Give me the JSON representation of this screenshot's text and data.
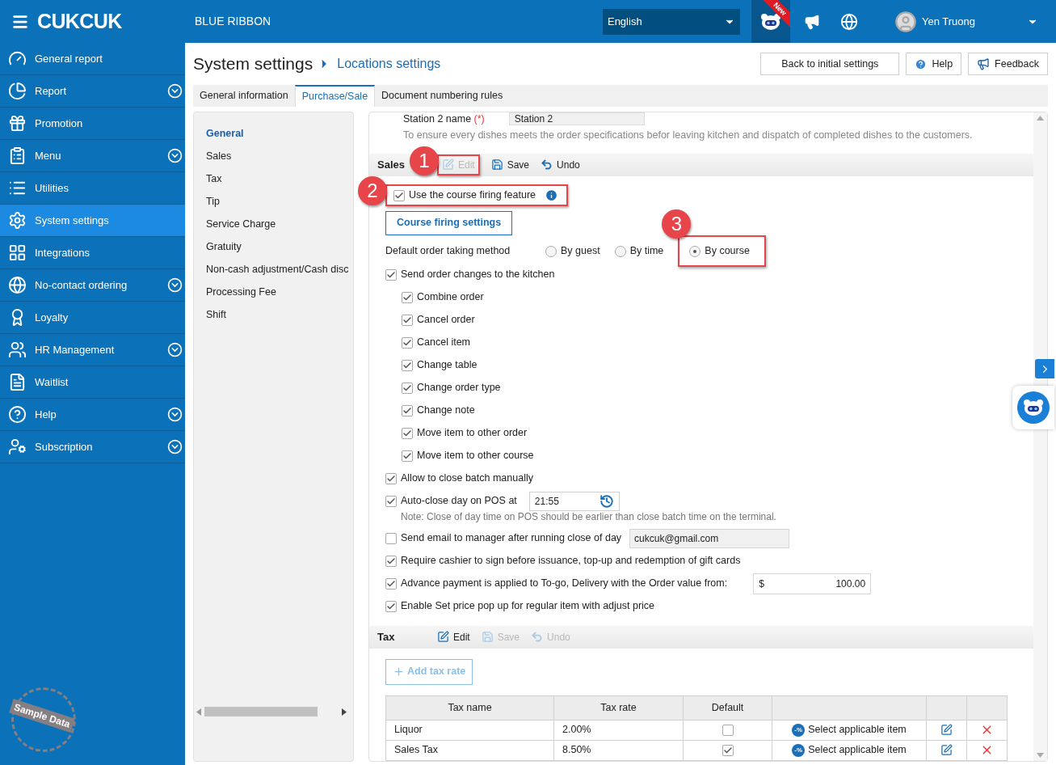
{
  "header": {
    "logo": "CUKCUK",
    "restaurant": "BLUE RIBBON",
    "language": "English",
    "new_badge": "New",
    "user": "Yen Truong"
  },
  "sidebar": {
    "items": [
      {
        "label": "General report",
        "selected": false,
        "expandable": false
      },
      {
        "label": "Report",
        "selected": false,
        "expandable": true
      },
      {
        "label": "Promotion",
        "selected": false,
        "expandable": false
      },
      {
        "label": "Menu",
        "selected": false,
        "expandable": true
      },
      {
        "label": "Utilities",
        "selected": false,
        "expandable": false
      },
      {
        "label": "System settings",
        "selected": true,
        "expandable": false
      },
      {
        "label": "Integrations",
        "selected": false,
        "expandable": false
      },
      {
        "label": "No-contact ordering",
        "selected": false,
        "expandable": true
      },
      {
        "label": "Loyalty",
        "selected": false,
        "expandable": false
      },
      {
        "label": "HR Management",
        "selected": false,
        "expandable": true
      },
      {
        "label": "Waitlist",
        "selected": false,
        "expandable": false
      },
      {
        "label": "Help",
        "selected": false,
        "expandable": true
      },
      {
        "label": "Subscription",
        "selected": false,
        "expandable": true
      }
    ],
    "stamp": "Sample Data"
  },
  "page": {
    "title": "System settings",
    "breadcrumb": "Locations settings",
    "buttons": [
      {
        "label": "Back to initial settings",
        "kind": "plain"
      },
      {
        "label": "Help",
        "kind": "help"
      },
      {
        "label": "Feedback",
        "kind": "feedback"
      }
    ]
  },
  "tabs": [
    {
      "label": "General information",
      "selected": false
    },
    {
      "label": "Purchase/Sale",
      "selected": true
    },
    {
      "label": "Document numbering rules",
      "selected": false
    }
  ],
  "settings_nav": [
    {
      "label": "General",
      "selected": true
    },
    {
      "label": "Sales",
      "selected": false
    },
    {
      "label": "Tax",
      "selected": false
    },
    {
      "label": "Tip",
      "selected": false
    },
    {
      "label": "Service Charge",
      "selected": false
    },
    {
      "label": "Gratuity",
      "selected": false
    },
    {
      "label": "Non-cash adjustment/Cash disc",
      "selected": false
    },
    {
      "label": "Processing Fee",
      "selected": false
    },
    {
      "label": "Shift",
      "selected": false
    }
  ],
  "station": {
    "label": "Station 2 name",
    "required": "(*)",
    "value": "Station 2",
    "note": "To ensure every dishes meets the order specifications befor leaving kitchen and dispatch of completed dishes to the customers."
  },
  "sales": {
    "title": "Sales",
    "toolbar": [
      {
        "label": "Edit",
        "kind": "edit",
        "disabled": true,
        "annotation": "1"
      },
      {
        "label": "Save",
        "kind": "save",
        "disabled": false
      },
      {
        "label": "Undo",
        "kind": "undo",
        "disabled": false
      }
    ],
    "options": [
      {
        "kind": "checkbox",
        "label": "Use the course firing feature",
        "checked": true,
        "info": true,
        "annotation": "2"
      },
      {
        "kind": "button",
        "label": "Course firing settings"
      },
      {
        "kind": "radio_group",
        "label": "Default order taking method",
        "options": [
          {
            "label": "By guest",
            "selected": false
          },
          {
            "label": "By time",
            "selected": false
          },
          {
            "label": "By course",
            "selected": true,
            "annotation": "3"
          }
        ]
      },
      {
        "kind": "checkbox",
        "label": "Send order changes to the kitchen",
        "checked": true,
        "children": [
          {
            "label": "Combine order",
            "checked": true
          },
          {
            "label": "Cancel order",
            "checked": true
          },
          {
            "label": "Cancel item",
            "checked": true
          },
          {
            "label": "Change table",
            "checked": true
          },
          {
            "label": "Change order type",
            "checked": true
          },
          {
            "label": "Change note",
            "checked": true
          },
          {
            "label": "Move item to other order",
            "checked": true
          },
          {
            "label": "Move item to other course",
            "checked": true
          }
        ]
      },
      {
        "kind": "checkbox",
        "label": "Allow to close batch manually",
        "checked": true
      },
      {
        "kind": "checkbox",
        "label": "Auto-close day on POS at",
        "checked": true,
        "field": {
          "value": "21:55",
          "kind": "time"
        }
      },
      {
        "kind": "note",
        "label": "Note: Close of day time on POS should be earlier than close batch time on the terminal."
      },
      {
        "kind": "checkbox",
        "label": "Send email to manager after running close of day",
        "checked": false,
        "field": {
          "value": "cukcuk@gmail.com",
          "kind": "email"
        }
      },
      {
        "kind": "checkbox",
        "label": "Require cashier to sign before issuance, top-up and redemption of gift cards",
        "checked": true
      },
      {
        "kind": "checkbox",
        "label": "Advance payment is applied to To-go, Delivery with the Order value from:",
        "checked": true,
        "field": {
          "value": "100.00",
          "prefix": "$",
          "kind": "money"
        }
      },
      {
        "kind": "checkbox",
        "label": "Enable Set price pop up for regular item with adjust price",
        "checked": true
      }
    ]
  },
  "tax": {
    "title": "Tax",
    "toolbar": [
      {
        "label": "Edit",
        "kind": "edit",
        "disabled": false
      },
      {
        "label": "Save",
        "kind": "save",
        "disabled": true
      },
      {
        "label": "Undo",
        "kind": "undo",
        "disabled": true
      }
    ],
    "add_button": "Add tax rate",
    "columns": [
      "Tax name",
      "Tax rate",
      "Default"
    ],
    "rows": [
      {
        "name": "Liquor",
        "rate": "2.00%",
        "default": false,
        "badge": "-%",
        "action": "Select applicable item"
      },
      {
        "name": "Sales Tax",
        "rate": "8.50%",
        "default": true,
        "badge": "-%",
        "action": "Select applicable item"
      }
    ]
  }
}
